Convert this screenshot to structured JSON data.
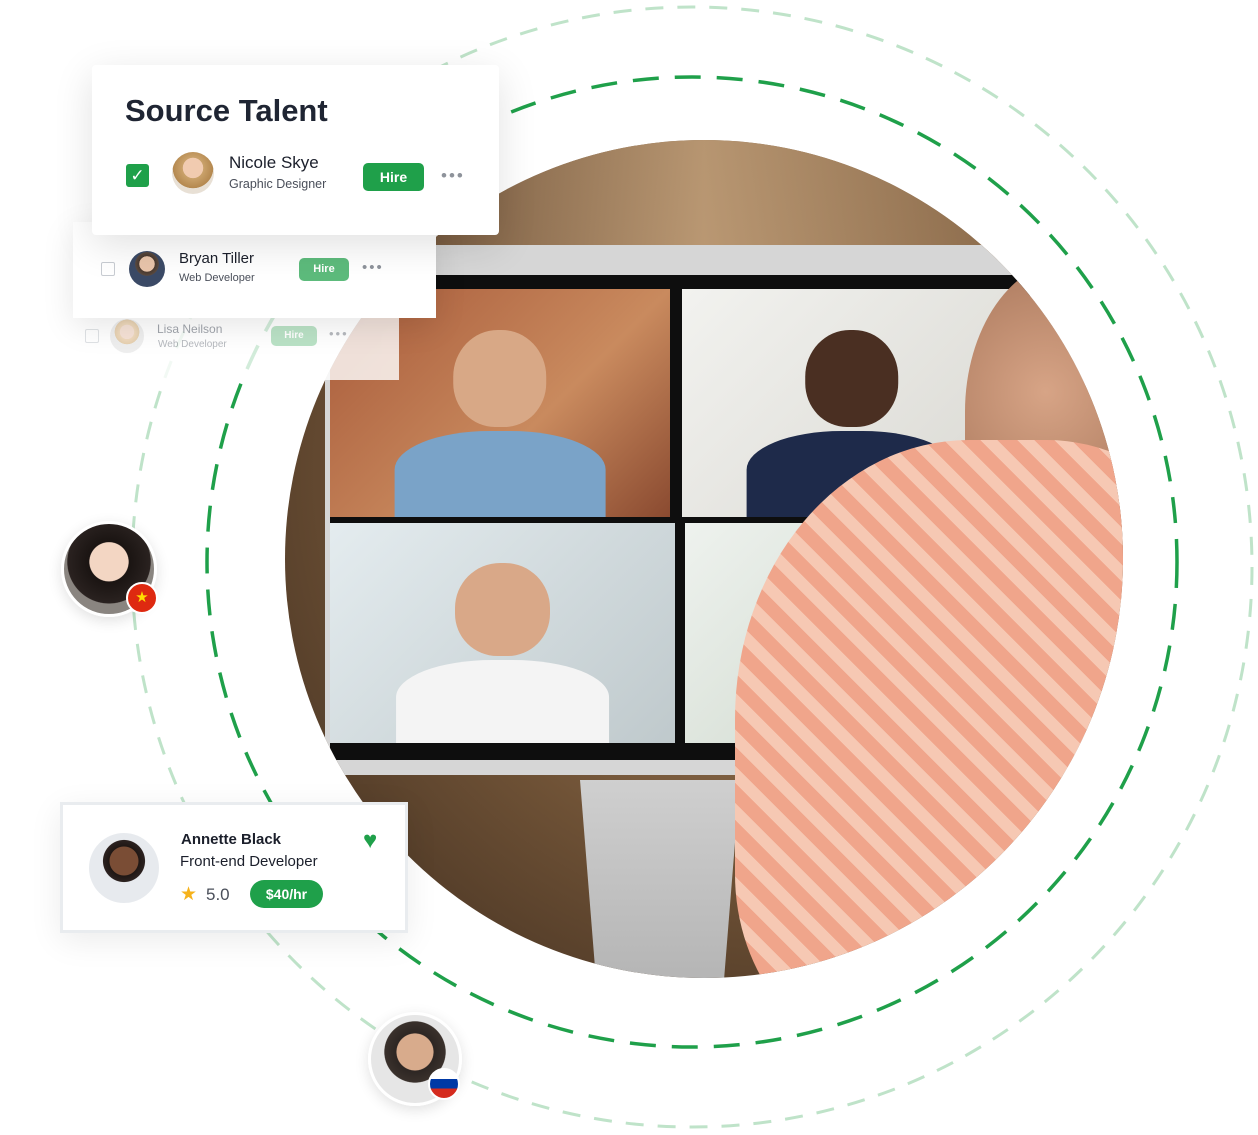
{
  "colors": {
    "accent": "#1fa04a",
    "accent_light": "#5dbb7c",
    "ring_light": "#bfe3c9"
  },
  "source_talent": {
    "title": "Source Talent",
    "candidates": [
      {
        "name": "Nicole Skye",
        "role": "Graphic Designer",
        "checked": true,
        "hire_label": "Hire"
      },
      {
        "name": "Bryan Tiller",
        "role": "Web Developer",
        "checked": false,
        "hire_label": "Hire"
      },
      {
        "name": "Lisa Neilson",
        "role": "Web Developer",
        "checked": false,
        "hire_label": "Hire"
      }
    ],
    "more_label": "•••"
  },
  "featured": {
    "name": "Annette Black",
    "role": "Front-end Developer",
    "rating": "5.0",
    "rate": "$40/hr",
    "flag": "us-flag-icon",
    "favorite_icon": "heart-icon"
  },
  "floating_avatars": [
    {
      "flag": "china-flag-icon"
    },
    {
      "flag": "russia-flag-icon"
    }
  ],
  "icons": {
    "check": "✓",
    "star": "★",
    "heart": "♥",
    "cn_star": "★"
  }
}
